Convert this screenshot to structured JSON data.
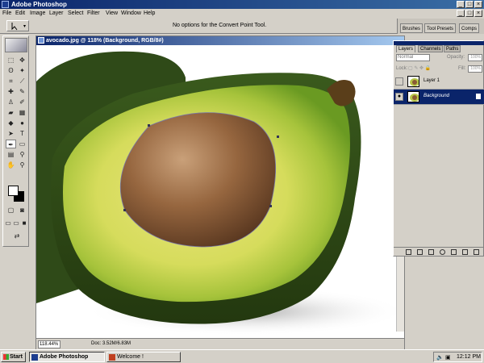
{
  "window": {
    "title": "Adobe Photoshop"
  },
  "menu": [
    "File",
    "Edit",
    "Image",
    "Layer",
    "Select",
    "Filter",
    "View",
    "Window",
    "Help"
  ],
  "options_bar": {
    "text": "No options for the Convert Point Tool."
  },
  "palette_well": {
    "tabs": [
      "Brushes",
      "Tool Presets",
      "Comps"
    ]
  },
  "document": {
    "title": "avocado.jpg @ 118% (Background, RGB/8#)",
    "zoom": "118.44%",
    "doc_size": "Doc: 3.52M/6.83M"
  },
  "layers_palette": {
    "tabs": [
      "Layers",
      "Channels",
      "Paths"
    ],
    "blend_mode": "Normal",
    "opacity_label": "Opacity:",
    "opacity_value": "100%",
    "lock_label": "Lock:",
    "fill_label": "Fill:",
    "fill_value": "100%",
    "layers": [
      {
        "name": "Layer 1",
        "visible": false,
        "selected": false
      },
      {
        "name": "Background",
        "visible": true,
        "selected": true
      }
    ]
  },
  "taskbar": {
    "start_label": "Start",
    "tasks": [
      {
        "label": "Adobe Photoshop",
        "active": true
      },
      {
        "label": "Welcome !",
        "active": false
      }
    ],
    "clock": "12:12 PM"
  },
  "colors": {
    "title_blue": "#0a246a",
    "selected_layer": "#0a246a",
    "chrome": "#d4d0c8"
  }
}
